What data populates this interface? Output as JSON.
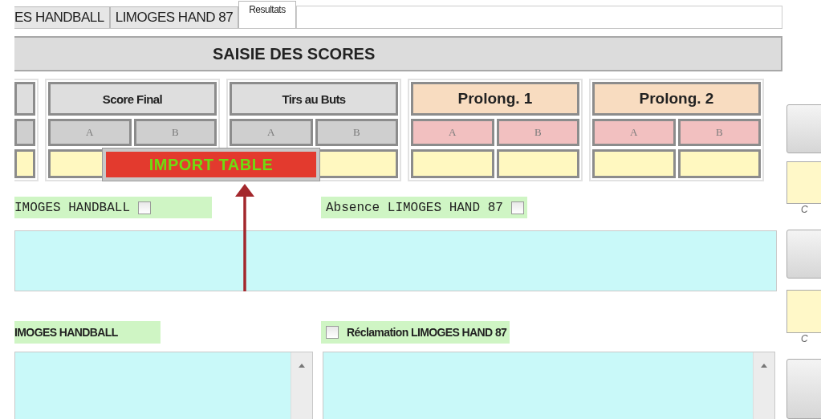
{
  "tabs": [
    {
      "label": "ES HANDBALL",
      "selected": false
    },
    {
      "label": "LIMOGES HAND 87",
      "selected": false
    },
    {
      "label": "Resultats",
      "selected": true
    }
  ],
  "title": "SAISIE DES SCORES",
  "score_groups": [
    {
      "kind": "standard"
    },
    {
      "kind": "standard",
      "label": "Score Final",
      "sub": [
        "A",
        "B"
      ]
    },
    {
      "kind": "standard",
      "label": "Tirs au Buts",
      "sub": [
        "A",
        "B"
      ]
    },
    {
      "kind": "overtime",
      "label": "Prolong. 1",
      "sub": [
        "A",
        "B"
      ]
    },
    {
      "kind": "overtime",
      "label": "Prolong. 2",
      "sub": [
        "A",
        "B"
      ]
    }
  ],
  "import_button": "IMPORT TABLE",
  "absence_row": [
    {
      "label": "IMOGES HANDBALL",
      "checked": false
    },
    {
      "label": "Absence LIMOGES HAND 87",
      "checked": false
    }
  ],
  "claim_row": [
    {
      "label": "IMOGES HANDBALL"
    },
    {
      "label": "Réclamation LIMOGES HAND 87",
      "checked": false
    }
  ],
  "side_captions": [
    "C",
    "C"
  ]
}
